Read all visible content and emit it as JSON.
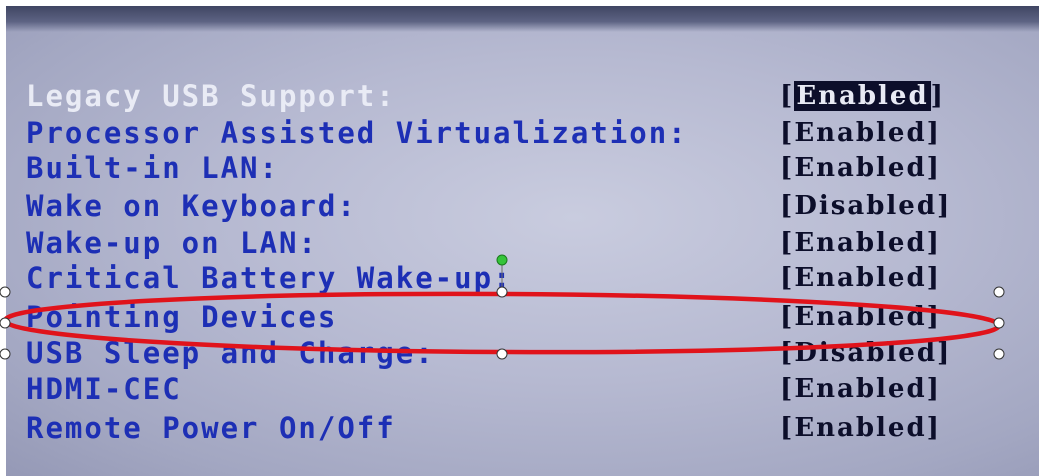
{
  "bios": {
    "settings": [
      {
        "label": "Legacy USB Support:",
        "value": "Enabled",
        "selected": true
      },
      {
        "label": "Processor Assisted Virtualization:",
        "value": "Enabled",
        "selected": false
      },
      {
        "label": "Built-in LAN:",
        "value": "Enabled",
        "selected": false
      },
      {
        "label": "Wake on Keyboard:",
        "value": "Disabled",
        "selected": false
      },
      {
        "label": "Wake-up on LAN:",
        "value": "Enabled",
        "selected": false
      },
      {
        "label": "Critical Battery Wake-up:",
        "value": "Enabled",
        "selected": false
      },
      {
        "label": "Pointing Devices",
        "value": "Enabled",
        "selected": false
      },
      {
        "label": "USB Sleep and Charge:",
        "value": "Disabled",
        "selected": false
      },
      {
        "label": "HDMI-CEC",
        "value": "Enabled",
        "selected": false
      },
      {
        "label": "Remote Power On/Off",
        "value": "Enabled",
        "selected": false
      }
    ]
  },
  "annotation": {
    "shape": "ellipse",
    "stroke_color": "#e0131b",
    "rotation_handle_color": "#35c43a"
  },
  "colors": {
    "label": "#1d2fb5",
    "selected_label": "#e9ebf5",
    "value": "#0c0e2a",
    "background": "#b6b9d1"
  }
}
